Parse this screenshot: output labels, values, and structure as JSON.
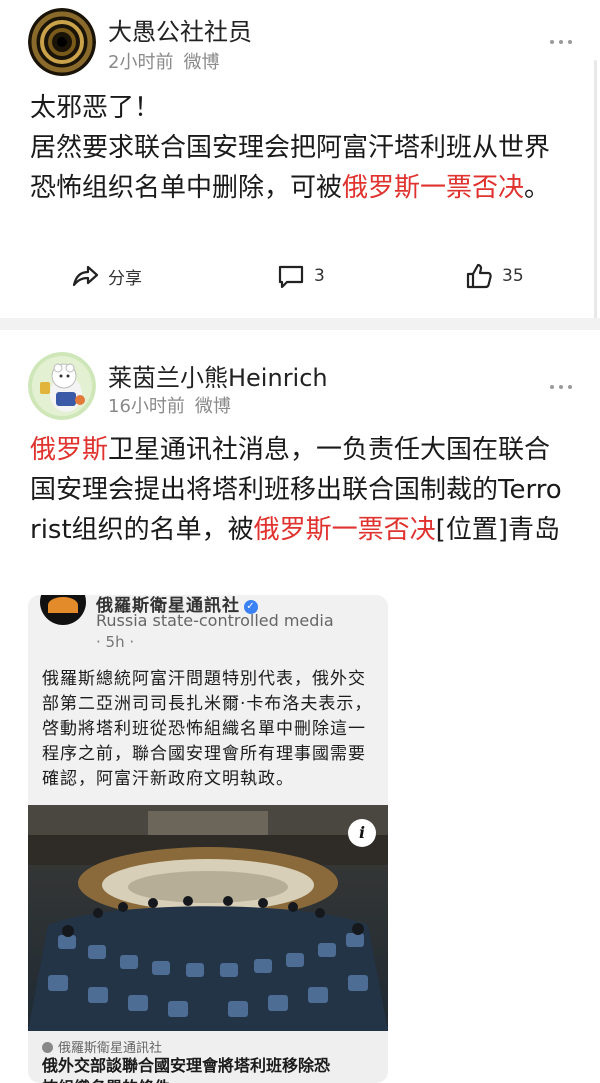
{
  "post1": {
    "username": "大愚公社社员",
    "time": "2小时前",
    "source": "微博",
    "text_line1": "太邪恶了！",
    "text_plain": "居然要求联合国安理会把阿富汗塔利班从世界恐怖组织名单中删除，可被",
    "text_red": "俄罗斯一票否决",
    "text_end": "。",
    "share_label": "分享",
    "comment_count": "3",
    "like_count": "35"
  },
  "post2": {
    "username": "莱茵兰小熊Heinrich",
    "time": "16小时前",
    "source": "微博",
    "text_red1": "俄罗斯",
    "text_mid": "卫星通讯社消息，一负责任大国在联合国安理会提出将塔利班移出联合国制裁的Terrorist组织的名单，被",
    "text_red2": "俄罗斯一票否决",
    "text_end": "[位置]青岛",
    "embed": {
      "account_name": "俄羅斯衛星通訊社",
      "account_label": "Russia state-controlled media",
      "time": "· 5h ·",
      "body": "俄羅斯總統阿富汗問題特別代表，俄外交部第二亞洲司司長扎米爾·卡布洛夫表示，啓動將塔利班從恐怖組織名單中刪除這一程序之前，聯合國安理會所有理事國需要確認，阿富汗新政府文明執政。",
      "info_icon": "i",
      "link_source": "俄羅斯衛星通訊社",
      "headline": "俄外交部談聯合國安理會將塔利班移除恐",
      "headline2": "怖組織名單的條件"
    }
  },
  "colors": {
    "accent_red": "#e0322e",
    "meta_gray": "#8a8a8a",
    "divider": "#f2f2f2"
  }
}
